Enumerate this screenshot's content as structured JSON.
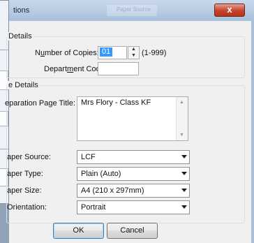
{
  "dialog": {
    "title": "tions",
    "blurred_tab": "Paper Source",
    "close_glyph": "x"
  },
  "copies_group": {
    "title": "Details",
    "copies_label_pre": "N",
    "copies_label_ul": "u",
    "copies_label_post": "mber of Copies:",
    "copies_value": "01",
    "copies_range": "(1-999)",
    "dept_label_pre": "Depart",
    "dept_label_ul": "m",
    "dept_label_post": "ent Code:",
    "dept_value": ""
  },
  "details_group": {
    "title": "e Details",
    "separation_label": "eparation Page Title:",
    "separation_value": "Mrs Flory - Class KF",
    "paper_source_label": "aper Source:",
    "paper_source_value": "LCF",
    "paper_type_label": "aper Type:",
    "paper_type_value": "Plain (Auto)",
    "paper_size_label": "aper Size:",
    "paper_size_value": "A4 (210 x 297mm)",
    "orientation_label": "Orientation:",
    "orientation_value": "Portrait"
  },
  "buttons": {
    "ok": "OK",
    "cancel": "Cancel"
  },
  "spin": {
    "up": "▲",
    "down": "▼"
  },
  "scroll": {
    "up": "▲",
    "down": "▼"
  }
}
